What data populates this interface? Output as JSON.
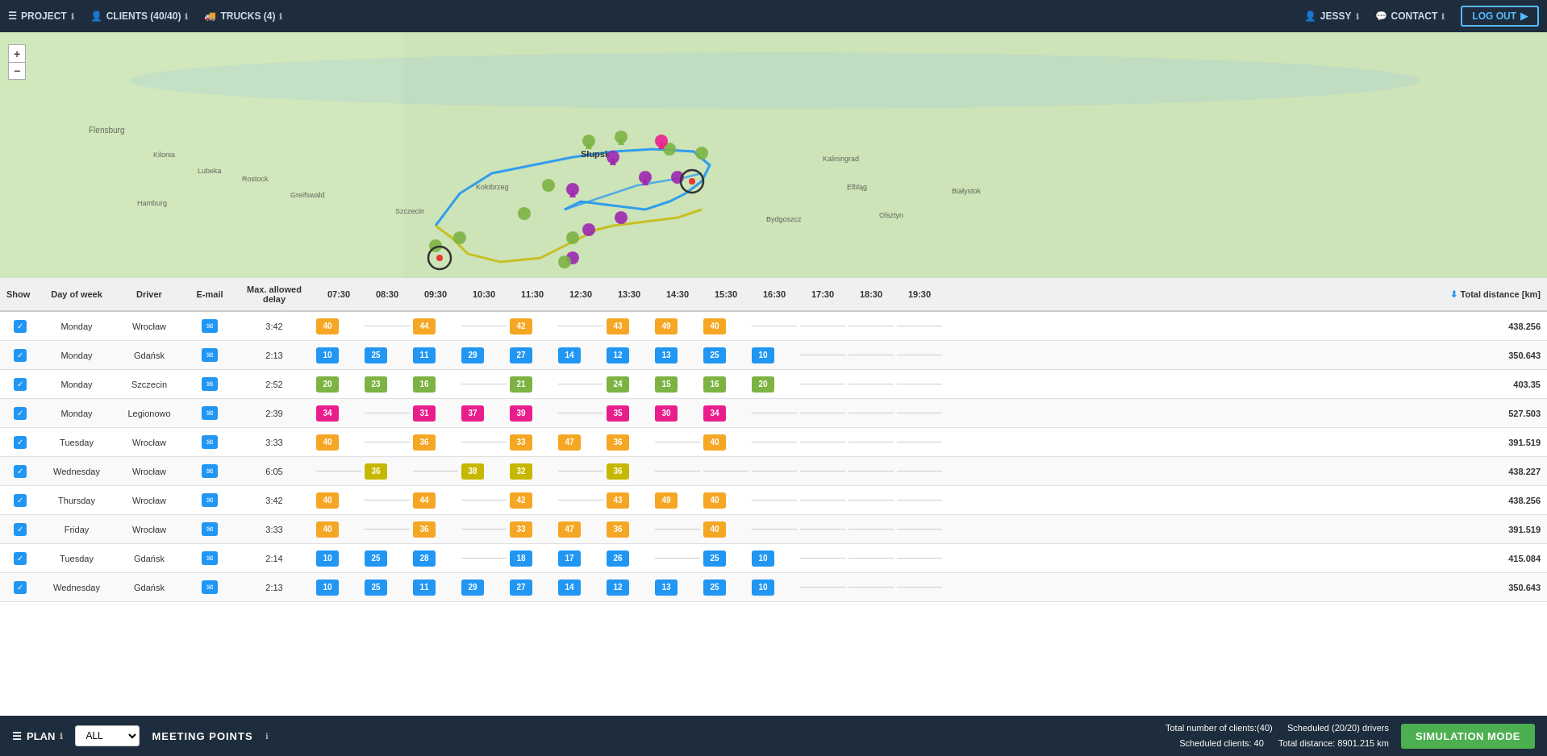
{
  "nav": {
    "project_label": "PROJECT",
    "clients_label": "CLIENTS (40/40)",
    "trucks_label": "TRUCKS (4)",
    "user_label": "JESSY",
    "contact_label": "CONTACT",
    "logout_label": "LOG OUT"
  },
  "schedule": {
    "columns": [
      "Show",
      "Day of week",
      "Driver",
      "E-mail",
      "Max. allowed delay",
      "07:30",
      "08:30",
      "09:30",
      "10:30",
      "11:30",
      "12:30",
      "13:30",
      "14:30",
      "15:30",
      "16:30",
      "17:30",
      "18:30",
      "19:30",
      "Total distance [km]"
    ],
    "rows": [
      {
        "day": "Monday",
        "driver": "Wrocław",
        "delay": "3:42",
        "distance": "438.256",
        "color": "orange",
        "bars": [
          {
            "col": 5,
            "val": "40"
          },
          {
            "col": 7,
            "val": "44"
          },
          {
            "col": 9,
            "val": "42"
          },
          {
            "col": 11,
            "val": "43"
          },
          {
            "col": 12,
            "val": "49"
          },
          {
            "col": 13,
            "val": "40"
          }
        ]
      },
      {
        "day": "Monday",
        "driver": "Gdańsk",
        "delay": "2:13",
        "distance": "350.643",
        "color": "blue",
        "bars": [
          {
            "col": 5,
            "val": "10"
          },
          {
            "col": 6,
            "val": "25"
          },
          {
            "col": 7,
            "val": "11"
          },
          {
            "col": 8,
            "val": "29"
          },
          {
            "col": 9,
            "val": "27"
          },
          {
            "col": 10,
            "val": "14"
          },
          {
            "col": 11,
            "val": "12"
          },
          {
            "col": 12,
            "val": "13"
          },
          {
            "col": 13,
            "val": "25"
          },
          {
            "col": 14,
            "val": "10"
          }
        ]
      },
      {
        "day": "Monday",
        "driver": "Szczecin",
        "delay": "2:52",
        "distance": "403.35",
        "color": "green",
        "bars": [
          {
            "col": 5,
            "val": "20"
          },
          {
            "col": 6,
            "val": "23"
          },
          {
            "col": 7,
            "val": "16"
          },
          {
            "col": 9,
            "val": "21"
          },
          {
            "col": 11,
            "val": "24"
          },
          {
            "col": 12,
            "val": "15"
          },
          {
            "col": 13,
            "val": "16"
          },
          {
            "col": 14,
            "val": "20"
          }
        ]
      },
      {
        "day": "Monday",
        "driver": "Legionowo",
        "delay": "2:39",
        "distance": "527.503",
        "color": "pink",
        "bars": [
          {
            "col": 5,
            "val": "34"
          },
          {
            "col": 7,
            "val": "31"
          },
          {
            "col": 8,
            "val": "37"
          },
          {
            "col": 9,
            "val": "39"
          },
          {
            "col": 11,
            "val": "35"
          },
          {
            "col": 12,
            "val": "30"
          },
          {
            "col": 13,
            "val": "34"
          }
        ]
      },
      {
        "day": "Tuesday",
        "driver": "Wrocław",
        "delay": "3:33",
        "distance": "391.519",
        "color": "orange",
        "bars": [
          {
            "col": 5,
            "val": "40"
          },
          {
            "col": 7,
            "val": "36"
          },
          {
            "col": 9,
            "val": "33"
          },
          {
            "col": 10,
            "val": "47"
          },
          {
            "col": 11,
            "val": "36"
          },
          {
            "col": 13,
            "val": "40"
          }
        ]
      },
      {
        "day": "Wednesday",
        "driver": "Wrocław",
        "delay": "6:05",
        "distance": "438.227",
        "color": "yellow",
        "bars": [
          {
            "col": 6,
            "val": "36"
          },
          {
            "col": 8,
            "val": "38"
          },
          {
            "col": 9,
            "val": "32"
          },
          {
            "col": 11,
            "val": "36"
          }
        ]
      },
      {
        "day": "Thursday",
        "driver": "Wrocław",
        "delay": "3:42",
        "distance": "438.256",
        "color": "orange",
        "bars": [
          {
            "col": 5,
            "val": "40"
          },
          {
            "col": 7,
            "val": "44"
          },
          {
            "col": 9,
            "val": "42"
          },
          {
            "col": 11,
            "val": "43"
          },
          {
            "col": 12,
            "val": "49"
          },
          {
            "col": 13,
            "val": "40"
          }
        ]
      },
      {
        "day": "Friday",
        "driver": "Wrocław",
        "delay": "3:33",
        "distance": "391.519",
        "color": "orange",
        "bars": [
          {
            "col": 5,
            "val": "40"
          },
          {
            "col": 7,
            "val": "36"
          },
          {
            "col": 9,
            "val": "33"
          },
          {
            "col": 10,
            "val": "47"
          },
          {
            "col": 11,
            "val": "36"
          },
          {
            "col": 13,
            "val": "40"
          }
        ]
      },
      {
        "day": "Tuesday",
        "driver": "Gdańsk",
        "delay": "2:14",
        "distance": "415.084",
        "color": "blue",
        "bars": [
          {
            "col": 5,
            "val": "10"
          },
          {
            "col": 6,
            "val": "25"
          },
          {
            "col": 7,
            "val": "28"
          },
          {
            "col": 9,
            "val": "18"
          },
          {
            "col": 10,
            "val": "17"
          },
          {
            "col": 11,
            "val": "26"
          },
          {
            "col": 13,
            "val": "25"
          },
          {
            "col": 14,
            "val": "10"
          }
        ]
      },
      {
        "day": "Wednesday",
        "driver": "Gdańsk",
        "delay": "2:13",
        "distance": "350.643",
        "color": "blue",
        "bars": [
          {
            "col": 5,
            "val": "10"
          },
          {
            "col": 6,
            "val": "25"
          },
          {
            "col": 7,
            "val": "11"
          },
          {
            "col": 8,
            "val": "29"
          },
          {
            "col": 9,
            "val": "27"
          },
          {
            "col": 10,
            "val": "14"
          },
          {
            "col": 11,
            "val": "12"
          },
          {
            "col": 12,
            "val": "13"
          },
          {
            "col": 13,
            "val": "25"
          },
          {
            "col": 14,
            "val": "10"
          }
        ]
      }
    ]
  },
  "bottom": {
    "plan_label": "PLAN",
    "all_option": "ALL",
    "meeting_points_label": "MEETING POINTS",
    "stats_clients": "Total number of clients:(40)",
    "stats_scheduled_clients": "Scheduled clients: 40",
    "stats_drivers": "Scheduled (20/20) drivers",
    "stats_distance": "Total distance: 8901.215 km",
    "sim_label": "SIMULATION MODE"
  },
  "colors": {
    "orange": "#f5a623",
    "blue": "#2196F3",
    "green": "#7cb342",
    "pink": "#e91e8c",
    "yellow": "#c6b800",
    "accent": "#4caf50"
  }
}
